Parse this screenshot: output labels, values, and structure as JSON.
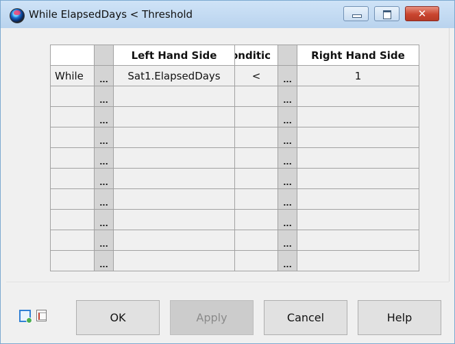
{
  "window": {
    "title": "While ElapsedDays < Threshold",
    "controls": {
      "minimize": "minimize",
      "maximize": "maximize",
      "close": "✕"
    }
  },
  "grid": {
    "headers": {
      "label": "",
      "lhs_button": "",
      "lhs": "Left Hand Side",
      "condition": "onditic",
      "rhs_button": "",
      "rhs": "Right Hand Side"
    },
    "ellipsis": "...",
    "rows": [
      {
        "label": "While",
        "lhs": "Sat1.ElapsedDays",
        "condition": "<",
        "rhs": "1"
      },
      {
        "label": "",
        "lhs": "",
        "condition": "",
        "rhs": ""
      },
      {
        "label": "",
        "lhs": "",
        "condition": "",
        "rhs": ""
      },
      {
        "label": "",
        "lhs": "",
        "condition": "",
        "rhs": ""
      },
      {
        "label": "",
        "lhs": "",
        "condition": "",
        "rhs": ""
      },
      {
        "label": "",
        "lhs": "",
        "condition": "",
        "rhs": ""
      },
      {
        "label": "",
        "lhs": "",
        "condition": "",
        "rhs": ""
      },
      {
        "label": "",
        "lhs": "",
        "condition": "",
        "rhs": ""
      },
      {
        "label": "",
        "lhs": "",
        "condition": "",
        "rhs": ""
      },
      {
        "label": "",
        "lhs": "",
        "condition": "",
        "rhs": ""
      }
    ]
  },
  "footer": {
    "icons": [
      "script-editor-icon",
      "command-summary-icon"
    ],
    "buttons": {
      "ok": "OK",
      "apply": "Apply",
      "cancel": "Cancel",
      "help": "Help"
    }
  }
}
